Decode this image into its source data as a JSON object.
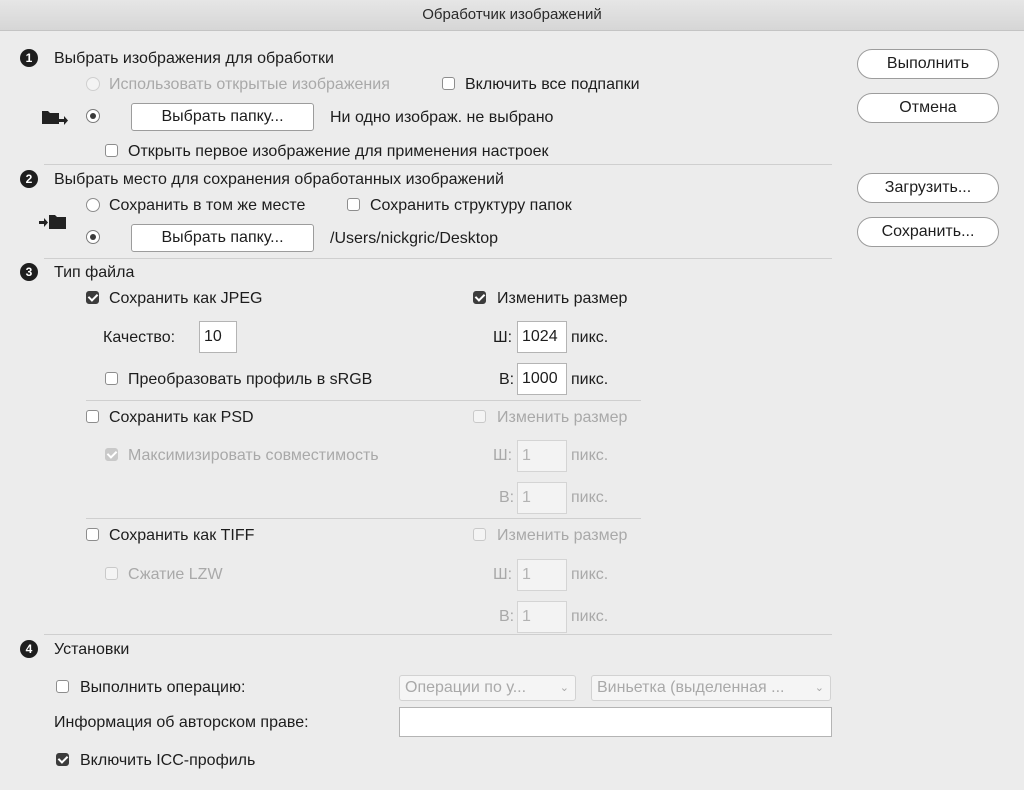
{
  "window": {
    "title": "Обработчик изображений"
  },
  "steps": {
    "n1": "1",
    "n2": "2",
    "n3": "3",
    "n4": "4"
  },
  "section1": {
    "title": "Выбрать изображения для обработки",
    "use_open_images": "Использовать открытые изображения",
    "include_subfolders": "Включить все подпапки",
    "choose_folder_label": "Выбрать папку...",
    "folder_status": "Ни одно изображ. не выбрано",
    "open_first": "Открыть первое изображение для применения настроек"
  },
  "section2": {
    "title": "Выбрать место для сохранения обработанных изображений",
    "save_same_place": "Сохранить в том же месте",
    "keep_folder_structure": "Сохранить структуру папок",
    "choose_folder_label": "Выбрать папку...",
    "folder_path": "/Users/nickgric/Desktop"
  },
  "section3": {
    "title": "Тип файла",
    "jpeg": {
      "save_as": "Сохранить как JPEG",
      "resize": "Изменить размер",
      "quality_label": "Качество:",
      "quality_value": "10",
      "convert_srgb": "Преобразовать профиль в sRGB",
      "w_label": "Ш:",
      "w_value": "1024",
      "h_label": "В:",
      "h_value": "1000",
      "unit": "пикс."
    },
    "psd": {
      "save_as": "Сохранить как PSD",
      "resize": "Изменить размер",
      "maximize": "Максимизировать совместимость",
      "w_label": "Ш:",
      "w_value": "1",
      "h_label": "В:",
      "h_value": "1",
      "unit": "пикс."
    },
    "tiff": {
      "save_as": "Сохранить как TIFF",
      "resize": "Изменить размер",
      "lzw": "Сжатие LZW",
      "w_label": "Ш:",
      "w_value": "1",
      "h_label": "В:",
      "h_value": "1",
      "unit": "пикс."
    }
  },
  "section4": {
    "title": "Установки",
    "run_action": "Выполнить операцию:",
    "action_set": "Операции по у...",
    "action_name": "Виньетка (выделенная ...",
    "copyright_label": "Информация об авторском праве:",
    "copyright_value": "",
    "include_icc": "Включить ICC-профиль"
  },
  "buttons": {
    "run": "Выполнить",
    "cancel": "Отмена",
    "load": "Загрузить...",
    "save": "Сохранить..."
  },
  "icons": {
    "source_folder": "folder-arrow-in-icon",
    "dest_folder": "folder-arrow-out-icon",
    "dropdown": "chevron-down-icon"
  },
  "colors": {
    "background": "#ececec",
    "checked": "#3c3c3c",
    "disabled_text": "#a9a9a9"
  }
}
